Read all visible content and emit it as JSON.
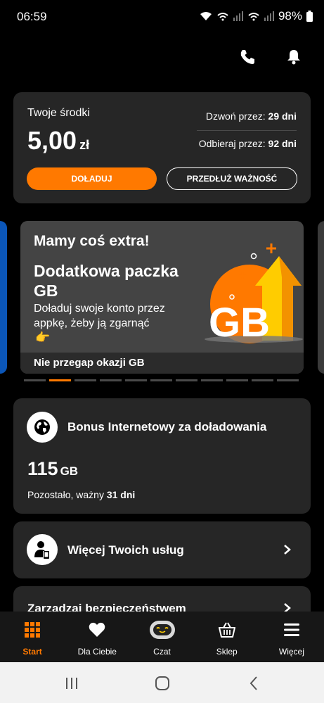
{
  "status_bar": {
    "time": "06:59",
    "battery": "98%"
  },
  "balance": {
    "label": "Twoje środki",
    "amount": "5,00",
    "currency": "zł",
    "call_label": "Dzwoń przez:",
    "call_value": "29 dni",
    "receive_label": "Odbieraj przez:",
    "receive_value": "92 dni",
    "topup_button": "DOŁADUJ",
    "extend_button": "PRZEDŁUŻ WAŻNOŚĆ"
  },
  "promo": {
    "title": "Mamy coś extra!",
    "headline": "Dodatkowa paczka GB",
    "description": "Doładuj swoje konto przez appkę, żeby ją zgarnąć",
    "emoji": "👉",
    "art_text": "GB",
    "footer": "Nie przegap okazji GB",
    "dot_count": 11,
    "active_dot": 2
  },
  "bonus": {
    "title": "Bonus Internetowy za doładowania",
    "amount": "115",
    "unit": "GB",
    "remaining_label": "Pozostało, ważny",
    "remaining_value": "31 dni"
  },
  "services": {
    "title": "Więcej Twoich usług"
  },
  "security": {
    "title": "Zarządzaj bezpieczeństwem"
  },
  "bottom_nav": [
    {
      "label": "Start",
      "icon": "grid-icon"
    },
    {
      "label": "Dla Ciebie",
      "icon": "heart-icon"
    },
    {
      "label": "Czat",
      "icon": "robot-icon"
    },
    {
      "label": "Sklep",
      "icon": "basket-icon"
    },
    {
      "label": "Więcej",
      "icon": "menu-icon"
    }
  ],
  "colors": {
    "accent": "#ff7900",
    "card": "#262626",
    "background": "#000000"
  }
}
